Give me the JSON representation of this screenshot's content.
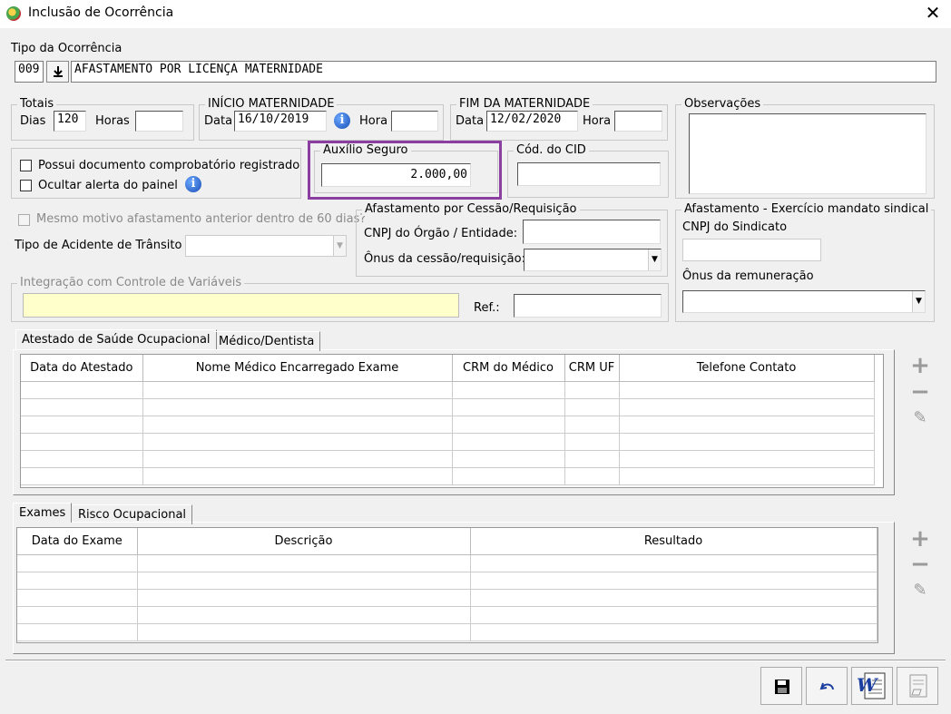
{
  "window": {
    "title": "Inclusão de Ocorrência",
    "close_label": "✕"
  },
  "tipo": {
    "label": "Tipo da Ocorrência",
    "code": "009",
    "picker_icon": "download-arrow-icon",
    "description": "AFASTAMENTO POR LICENÇA MATERNIDADE"
  },
  "totais": {
    "title": "Totais",
    "dias_label": "Dias",
    "dias_value": "120",
    "horas_label": "Horas",
    "horas_value": ""
  },
  "inicio": {
    "title": "INÍCIO MATERNIDADE",
    "data_label": "Data",
    "data_value": "16/10/2019",
    "hora_label": "Hora",
    "hora_value": ""
  },
  "fim": {
    "title": "FIM DA MATERNIDADE",
    "data_label": "Data",
    "data_value": "12/02/2020",
    "hora_label": "Hora",
    "hora_value": ""
  },
  "observacoes": {
    "title": "Observações",
    "value": ""
  },
  "checks": {
    "possui_doc": "Possui documento comprobatório registrado",
    "ocultar_alerta": "Ocultar alerta do painel"
  },
  "auxilio": {
    "title": "Auxílio Seguro",
    "value": "2.000,00",
    "highlight_color": "#8b3fa0"
  },
  "cid": {
    "title": "Cód. do CID",
    "value": ""
  },
  "mesmo_motivo": "Mesmo motivo afastamento anterior dentro de 60 dias?",
  "acidente": {
    "label": "Tipo de Acidente de Trânsito",
    "value": ""
  },
  "cessao": {
    "title": "Afastamento por Cessão/Requisição",
    "cnpj_label": "CNPJ do Órgão / Entidade:",
    "cnpj_value": "",
    "onus_label": "Ônus da cessão/requisição:",
    "onus_value": ""
  },
  "sindical": {
    "title": "Afastamento - Exercício mandato sindical",
    "cnpj_label": "CNPJ do Sindicato",
    "cnpj_value": "",
    "onus_label": "Ônus da remuneração",
    "onus_value": ""
  },
  "integracao": {
    "title": "Integração com Controle de Variáveis",
    "value": "",
    "ref_label": "Ref.:",
    "ref_value": "",
    "field_color": "#ffffcc"
  },
  "tabs1": [
    {
      "label": "Atestado de Saúde Ocupacional"
    },
    {
      "label": "Médico/Dentista"
    }
  ],
  "grid1": {
    "columns": [
      "Data do Atestado",
      "Nome Médico Encarregado Exame",
      "CRM do Médico",
      "CRM UF",
      "Telefone Contato"
    ]
  },
  "tabs2": [
    {
      "label": "Exames"
    },
    {
      "label": "Risco Ocupacional"
    }
  ],
  "grid2": {
    "columns": [
      "Data do Exame",
      "Descrição",
      "Resultado"
    ]
  },
  "side_buttons": {
    "add": "+",
    "remove": "−",
    "edit": "✎"
  },
  "toolbar": {
    "save_icon": "floppy-disk-icon",
    "undo_icon": "undo-icon",
    "word_icon": "word-document-icon",
    "report_icon": "report-icon"
  }
}
